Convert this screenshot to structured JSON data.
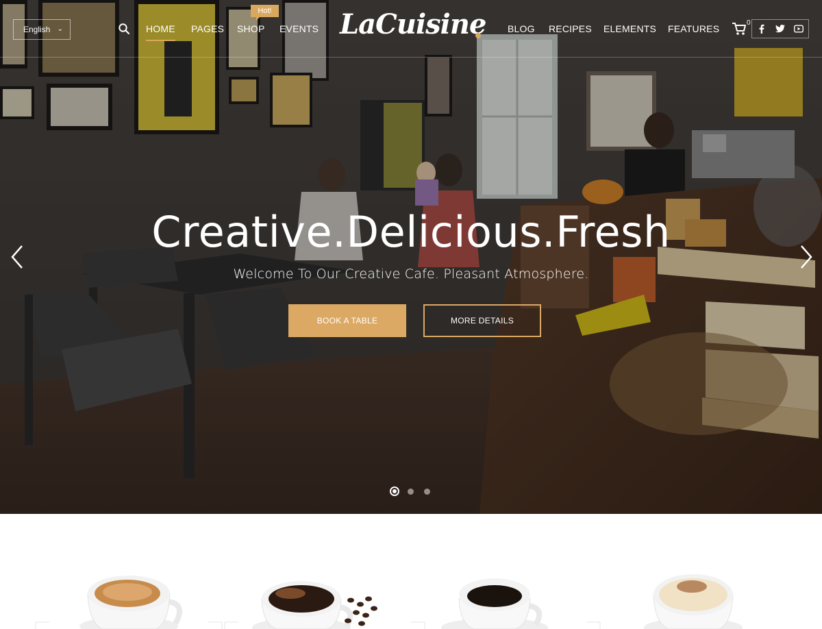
{
  "header": {
    "language": "English",
    "nav_left": [
      "HOME",
      "PAGES",
      "SHOP",
      "EVENTS"
    ],
    "shop_badge": "Hot!",
    "logo": "LaCuisine",
    "nav_right": [
      "BLOG",
      "RECIPES",
      "ELEMENTS",
      "FEATURES"
    ],
    "cart_count": "0",
    "social_icons": [
      "facebook-icon",
      "twitter-icon",
      "youtube-icon"
    ]
  },
  "hero": {
    "title": "Creative.Delicious.Fresh",
    "subtitle": "Welcome To Our Creative Cafe. Pleasant Atmosphere.",
    "primary_button": "BOOK A TABLE",
    "secondary_button": "MORE DETAILS",
    "slides": 3,
    "active_slide": 1
  },
  "colors": {
    "accent": "#dba964",
    "white": "#ffffff"
  }
}
